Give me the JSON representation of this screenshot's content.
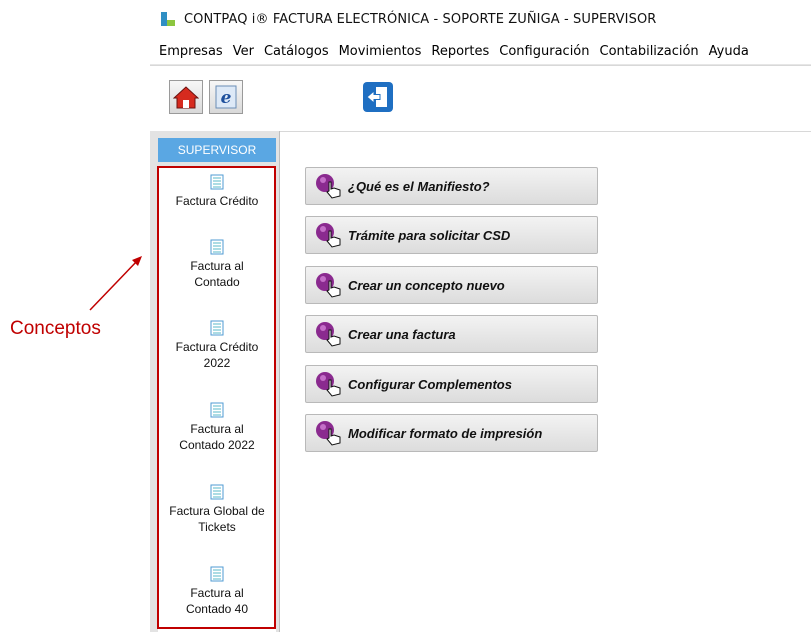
{
  "window": {
    "title": "CONTPAQ i® FACTURA ELECTRÓNICA - SOPORTE ZUÑIGA - SUPERVISOR",
    "app_icon": "contpaqi-app-icon"
  },
  "menu": {
    "items": [
      "Empresas",
      "Ver",
      "Catálogos",
      "Movimientos",
      "Reportes",
      "Configuración",
      "Contabilización",
      "Ayuda"
    ]
  },
  "toolbar": {
    "buttons": [
      {
        "icon": "home-icon"
      },
      {
        "icon": "e-document-icon"
      },
      {
        "icon": "exit-door-icon"
      }
    ]
  },
  "left_panel": {
    "tab_label": "SUPERVISOR",
    "concepts": [
      {
        "label": "Factura Crédito",
        "icon": "document-icon"
      },
      {
        "label": "Factura al Contado",
        "icon": "document-icon"
      },
      {
        "label": "Factura Crédito 2022",
        "icon": "document-icon"
      },
      {
        "label": "Factura al Contado 2022",
        "icon": "document-icon"
      },
      {
        "label": "Factura Global de Tickets",
        "icon": "document-icon"
      },
      {
        "label": "Factura al Contado 40",
        "icon": "document-icon"
      }
    ]
  },
  "actions": [
    {
      "label": "¿Qué es el Manifiesto?",
      "icon": "hand-pointer-icon"
    },
    {
      "label": "Trámite para solicitar CSD",
      "icon": "hand-pointer-icon"
    },
    {
      "label": "Crear un concepto nuevo",
      "icon": "hand-pointer-icon"
    },
    {
      "label": "Crear una factura",
      "icon": "hand-pointer-icon"
    },
    {
      "label": "Configurar Complementos",
      "icon": "hand-pointer-icon"
    },
    {
      "label": "Modificar formato de impresión",
      "icon": "hand-pointer-icon"
    }
  ],
  "annotation": {
    "label": "Conceptos",
    "color": "#c00000"
  },
  "colors": {
    "tab": "#5aa7e3",
    "highlight_box": "#c00000"
  }
}
